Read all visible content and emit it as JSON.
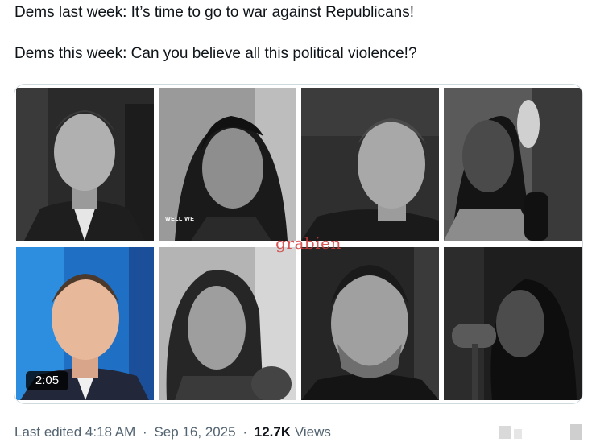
{
  "post": {
    "line1": "Dems last week: It’s time to go to war against Republicans!",
    "line2": "Dems this week: Can you believe all this political violence!?"
  },
  "media": {
    "watermark": "grabien",
    "caption": "WELL WE",
    "duration": "2:05"
  },
  "meta": {
    "edited_label": "Last edited",
    "time": "4:18 AM",
    "separator": "·",
    "date": "Sep 16, 2025",
    "views_count": "12.7K",
    "views_label": "Views"
  },
  "colors": {
    "text_primary": "#0f1419",
    "text_secondary": "#536471",
    "border": "#cfd9de",
    "watermark": "#d23a3a"
  }
}
